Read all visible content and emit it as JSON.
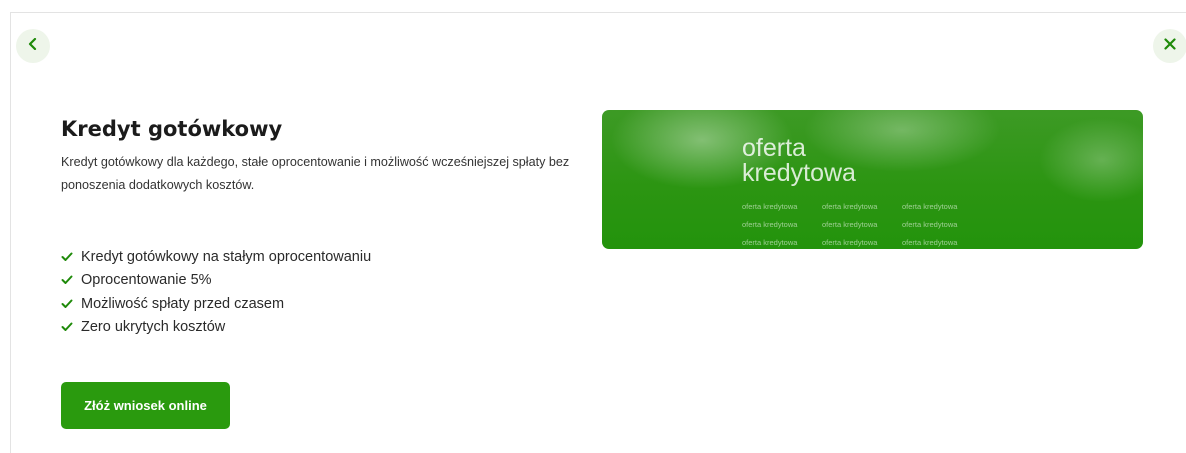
{
  "colors": {
    "accent": "#2a9a0e",
    "icon_bg": "#eef5ea",
    "banner_green": "#2c9512"
  },
  "header": {
    "back_icon": "chevron-left-icon",
    "close_icon": "close-icon"
  },
  "offer": {
    "title": "Kredyt gotówkowy",
    "description": "Kredyt gotówkowy dla każdego, stałe oprocentowanie i możliwość wcześniejszej spłaty bez ponoszenia dodatkowych kosztów.",
    "features": [
      "Kredyt gotówkowy na stałym oprocentowaniu",
      "Oprocentowanie 5%",
      "Możliwość spłaty przed czasem",
      "Zero ukrytych kosztów"
    ],
    "feature_icon": "check-icon",
    "cta_label": "Złóż wniosek online"
  },
  "banner": {
    "line1": "oferta",
    "line2": "kredytowa",
    "small": [
      "oferta kredytowa",
      "oferta kredytowa",
      "oferta kredytowa",
      "oferta kredytowa",
      "oferta kredytowa",
      "oferta kredytowa",
      "oferta kredytowa",
      "oferta kredytowa",
      "oferta kredytowa"
    ]
  }
}
